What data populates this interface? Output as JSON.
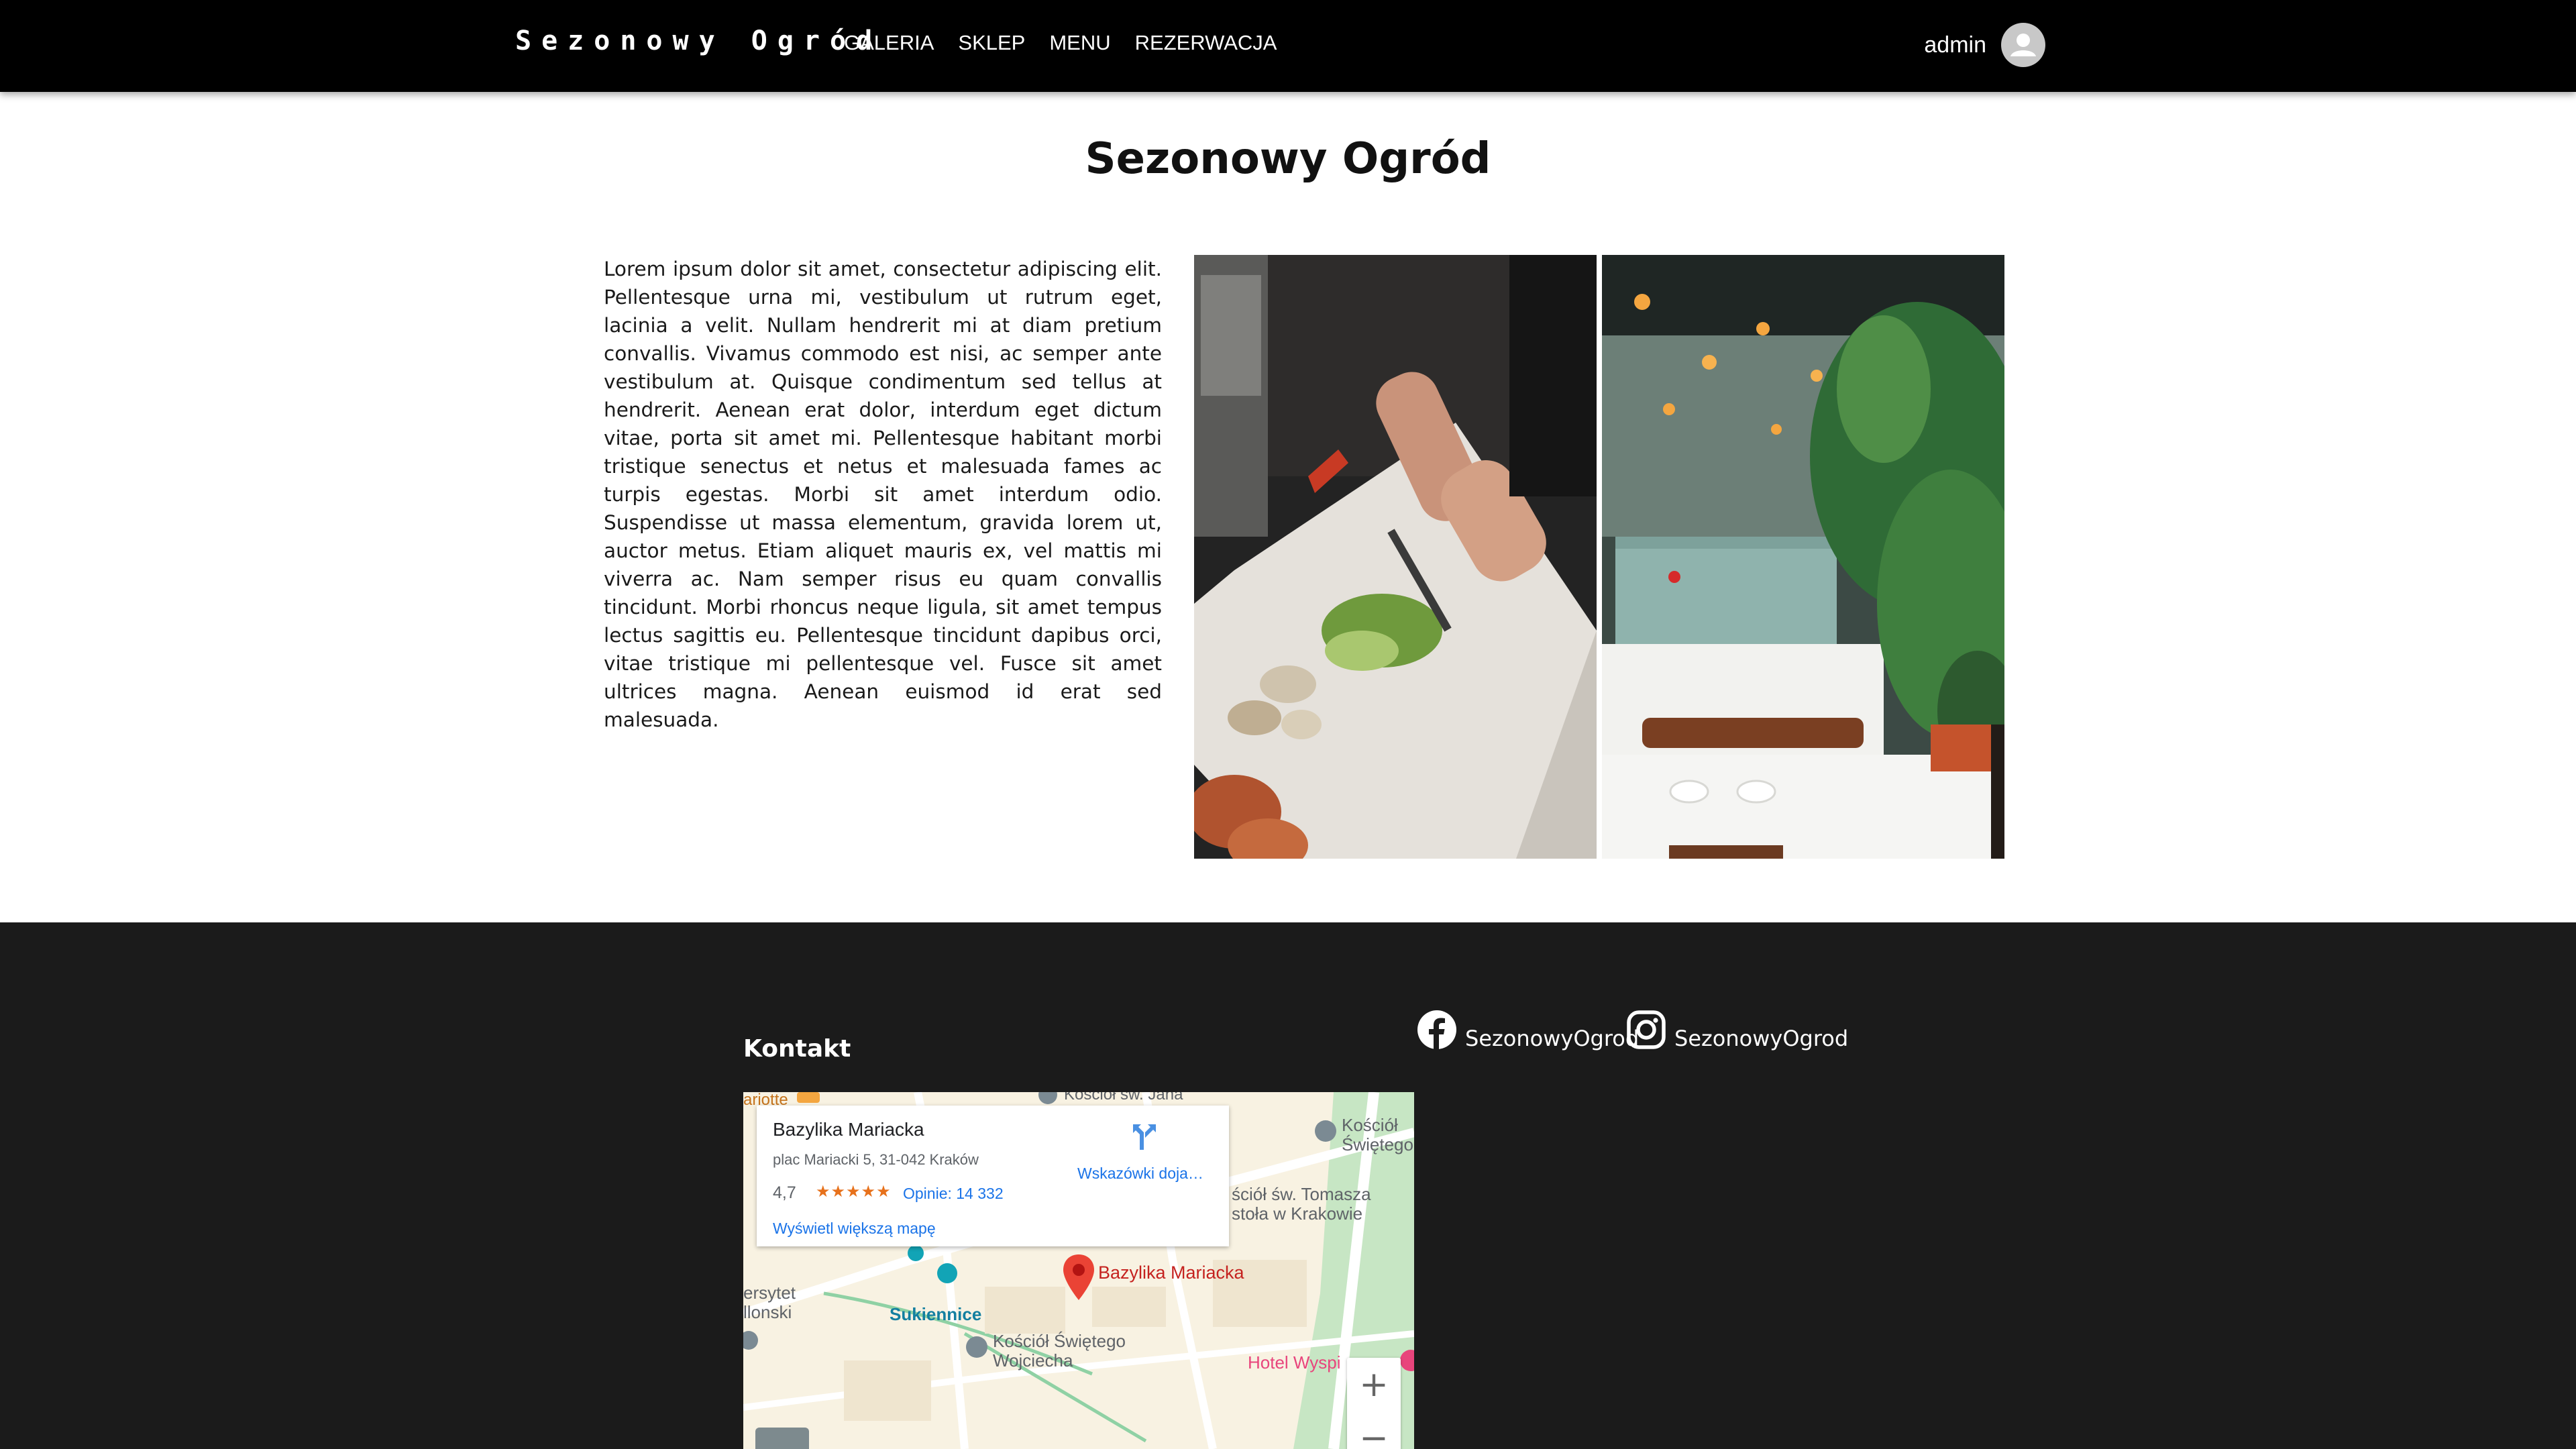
{
  "navbar": {
    "brand": "Sezonowy Ogród",
    "links": [
      "GALERIA",
      "SKLEP",
      "MENU",
      "REZERWACJA"
    ],
    "user": "admin"
  },
  "main": {
    "title": "Sezonowy Ogród",
    "paragraph": "Lorem ipsum dolor sit amet, consectetur adipiscing elit. Pellentesque urna mi, vestibulum ut rutrum eget, lacinia a velit. Nullam hendrerit mi at diam pretium convallis. Vivamus commodo est nisi, ac semper ante vestibulum at. Quisque condimentum sed tellus at hendrerit. Aenean erat dolor, interdum eget dictum vitae, porta sit amet mi. Pellentesque habitant morbi tristique senectus et netus et malesuada fames ac turpis egestas. Morbi sit amet interdum odio. Suspendisse ut massa elementum, gravida lorem ut, auctor metus. Etiam aliquet mauris ex, vel mattis mi viverra ac. Nam semper risus eu quam convallis tincidunt. Morbi rhoncus neque ligula, sit amet tempus lectus sagittis eu. Pellentesque tincidunt dapibus orci, vitae tristique mi pellentesque vel. Fusce sit amet ultrices magna. Aenean euismod id erat sed malesuada."
  },
  "footer": {
    "contact_heading": "Kontakt",
    "facebook": "SezonowyOgrod",
    "instagram": "SezonowyOgrod",
    "map": {
      "place_name": "Bazylika Mariacka",
      "address": "plac Mariacki 5, 31-042 Kraków",
      "rating": "4,7",
      "stars": "★★★★★",
      "reviews": "Opinie: 14 332",
      "directions": "Wskazówki doja…",
      "larger_map": "Wyświetl większą mapę",
      "pin_label": "Bazylika Mariacka",
      "labels": {
        "sukiennice": "Sukiennice",
        "wojciech_1": "Kościół Świętego",
        "wojciech_2": "Wojciecha",
        "tomasza_1": "ściół św. Tomasza",
        "tomasza_2": "stoła w Krakowie",
        "kosciol_1": "Kościół",
        "kosciol_2": "Świętego",
        "kosciol_jana": "Kościół św. Jana",
        "hotel": "Hotel Wyspi",
        "uni_1": "ersytet",
        "uni_2": "llonski",
        "mariott": "ariotte"
      },
      "zoom_in": "+",
      "zoom_out": "−"
    }
  },
  "colors": {
    "navbar": "#000000",
    "footer": "#1b1b1b",
    "map_pin": "#ea4335",
    "map_link": "#1a73e8"
  },
  "icons": [
    "user-avatar-icon",
    "facebook-icon",
    "instagram-icon",
    "directions-icon",
    "map-pin-icon"
  ]
}
